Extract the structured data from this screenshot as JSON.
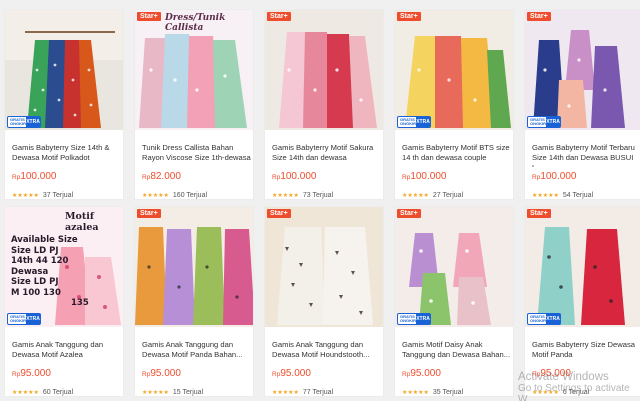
{
  "badges": {
    "star": "Star+",
    "ship_left": "GRATIS ONGKIR",
    "ship_right": "XTRA"
  },
  "watermark": {
    "line1": "Activate Windows",
    "line2": "Go to Settings to activate W"
  },
  "products": [
    {
      "title": "Gamis Babyterry Size 14th & Dewasa Motif Polkadot",
      "currency": "Rp",
      "price": "100.000",
      "stars": "★★★★★",
      "sold": "37 Terjual",
      "overlay": ""
    },
    {
      "title": "Tunik Dress Callista Bahan Rayon Viscose Size 1th-dewasa",
      "currency": "Rp",
      "price": "82.000",
      "stars": "★★★★★",
      "sold": "160 Terjual",
      "overlay": "Dress/Tunik Callista"
    },
    {
      "title": "Gamis Babyterry Motif Sakura Size 14th dan dewasa",
      "currency": "Rp",
      "price": "100.000",
      "stars": "★★★★★",
      "sold": "73 Terjual",
      "overlay": ""
    },
    {
      "title": "Gamis Babyterry Motif BTS size 14 th dan dewasa couple",
      "currency": "Rp",
      "price": "100.000",
      "stars": "★★★★★",
      "sold": "27 Terjual",
      "overlay": ""
    },
    {
      "title": "Gamis Babyterry Motif Terbaru Size 14th dan Dewasa BUSUI L...",
      "currency": "Rp",
      "price": "100.000",
      "stars": "★★★★★",
      "sold": "54 Terjual",
      "overlay": ""
    },
    {
      "title": "Gamis Anak Tanggung dan Dewasa Motif Azalea",
      "currency": "Rp",
      "price": "95.000",
      "stars": "★★★★★",
      "sold": "60 Terjual",
      "overlay": "Motif azalea"
    },
    {
      "title": "Gamis Anak Tanggung dan Dewasa Motif Panda Bahan...",
      "currency": "Rp",
      "price": "95.000",
      "stars": "★★★★★",
      "sold": "15 Terjual",
      "overlay": ""
    },
    {
      "title": "Gamis Anak Tanggung dan Dewasa Motif Houndstooth...",
      "currency": "Rp",
      "price": "95.000",
      "stars": "★★★★★",
      "sold": "77 Terjual",
      "overlay": ""
    },
    {
      "title": "Gamis Motif Daisy Anak Tanggung dan Dewasa Bahan...",
      "currency": "Rp",
      "price": "95.000",
      "stars": "★★★★★",
      "sold": "35 Terjual",
      "overlay": ""
    },
    {
      "title": "Gamis Babyterry Size Dewasa Motif Panda",
      "currency": "Rp",
      "price": "95.000",
      "stars": "★★★★★",
      "sold": "6 Terjual",
      "overlay": ""
    }
  ],
  "azalea_sizes": {
    "heading": "Available Size",
    "line1": "Size LD  PJ",
    "line2": "14th 44  120",
    "line3": "Dewasa",
    "line4": "Size LD  PJ",
    "line5": "M  100  130",
    "line6": "135"
  }
}
